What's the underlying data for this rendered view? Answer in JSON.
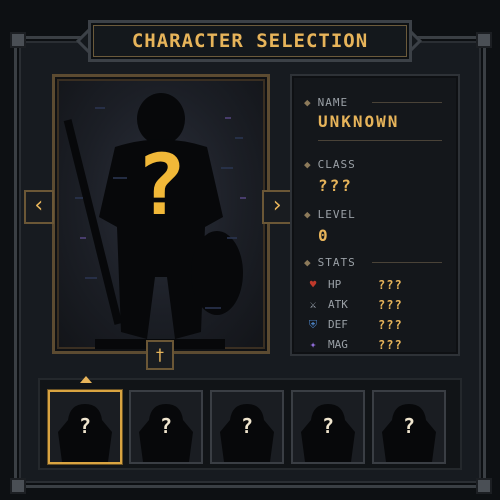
{
  "title": "CHARACTER SELECTION",
  "portrait": {
    "mystery_mark": "?",
    "prev_glyph": "‹",
    "next_glyph": "›",
    "emblem_glyph": "†"
  },
  "info": {
    "name_label": "NAME",
    "name_value": "UNKNOWN",
    "class_label": "CLASS",
    "class_value": "???",
    "level_label": "LEVEL",
    "level_value": "0",
    "stats_label": "STATS",
    "stats": [
      {
        "name": "HP",
        "value": "???",
        "icon": "heart-icon",
        "color": "#c0392b",
        "glyph": "♥"
      },
      {
        "name": "ATK",
        "value": "???",
        "icon": "sword-icon",
        "color": "#a9b3bf",
        "glyph": "⚔"
      },
      {
        "name": "DEF",
        "value": "???",
        "icon": "shield-icon",
        "color": "#4a7fc0",
        "glyph": "⛨"
      },
      {
        "name": "MAG",
        "value": "???",
        "icon": "magic-icon",
        "color": "#8e6bd6",
        "glyph": "✦"
      }
    ]
  },
  "slots": [
    {
      "mark": "?",
      "selected": true
    },
    {
      "mark": "?",
      "selected": false
    },
    {
      "mark": "?",
      "selected": false
    },
    {
      "mark": "?",
      "selected": false
    },
    {
      "mark": "?",
      "selected": false
    }
  ],
  "colors": {
    "accent": "#e7b45a",
    "frame": "#5c4b31",
    "background": "#171b20"
  }
}
